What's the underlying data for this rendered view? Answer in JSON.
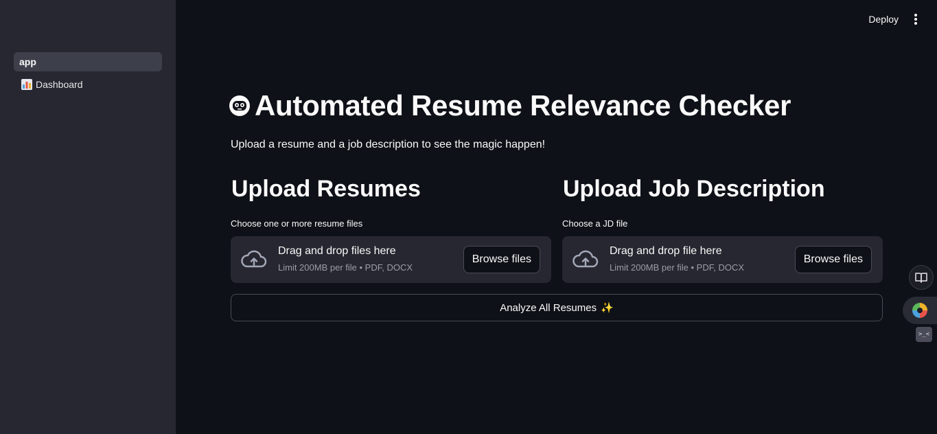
{
  "sidebar": {
    "items": [
      {
        "label": "app",
        "active": true
      },
      {
        "label": "Dashboard",
        "icon": "bar-chart-icon"
      }
    ]
  },
  "header": {
    "deploy_label": "Deploy",
    "menu_icon": "kebab-menu-icon"
  },
  "main": {
    "title": "Automated Resume Relevance Checker",
    "title_icon": "robot-face-icon",
    "subtitle": "Upload a resume and a job description to see the magic happen!",
    "resumes": {
      "heading": "Upload Resumes",
      "label": "Choose one or more resume files",
      "drop_title": "Drag and drop files here",
      "limit": "Limit 200MB per file • PDF, DOCX",
      "browse_label": "Browse files"
    },
    "jd": {
      "heading": "Upload Job Description",
      "label": "Choose a JD file",
      "drop_title": "Drag and drop file here",
      "limit": "Limit 200MB per file • PDF, DOCX",
      "browse_label": "Browse files"
    },
    "analyze_label": "Analyze All Resumes",
    "analyze_emoji": "✨"
  },
  "colors": {
    "background": "#0e1117",
    "sidebar": "#262730",
    "dropzone": "#262730",
    "text": "#fafafa",
    "muted": "#9c9da5"
  }
}
